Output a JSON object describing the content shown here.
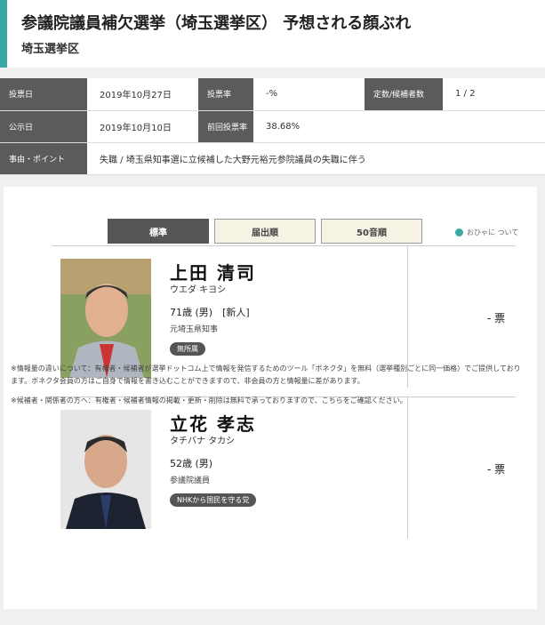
{
  "header": {
    "title": "参議院議員補欠選挙（埼玉選挙区） 予想される顔ぶれ",
    "subtitle": "埼玉選挙区"
  },
  "info": [
    {
      "label": "投票日",
      "value": "2019年10月27日"
    },
    {
      "label": "投票率",
      "value": "-%"
    },
    {
      "label": "定数/候補者数",
      "value": "1 / 2"
    },
    {
      "label": "公示日",
      "value": "2019年10月10日"
    },
    {
      "label": "前回投票率",
      "value": "38.68%"
    },
    {
      "label": "事由・ポイント",
      "value": "失職 / 埼玉県知事選に立候補した大野元裕元参院議員の失職に伴う"
    }
  ],
  "tabs": [
    {
      "label": "標準",
      "active": true
    },
    {
      "label": "届出順",
      "active": false
    },
    {
      "label": "50音順",
      "active": false
    }
  ],
  "legend": "おひゃに ついて",
  "candidates": [
    {
      "name": "上田 清司",
      "kana": "ウエダ キヨシ",
      "age": "71歳 (男)",
      "status": "[新人]",
      "role": "元埼玉県知事",
      "party": "無所属",
      "votes": "- 票"
    },
    {
      "name": "立花 孝志",
      "kana": "タチバナ タカシ",
      "age": "52歳 (男)",
      "status": "",
      "role": "参議院議員",
      "party": "NHKから国民を守る党",
      "votes": "- 票"
    }
  ],
  "notes": [
    "※情報量の違いについて：有権者・候補者が選挙ドットコム上で情報を発信するためのツール「ボネクタ」を無料（選挙種別ごとに同一価格）でご提供しております。ボネクタ会員の方はご自身で情報を書き込むことができますので、非会員の方と情報量に差があります。",
    "※候補者・関係者の方へ：有権者・候補者情報の掲載・更新・削除は無料で承っておりますので、こちらをご確認ください。"
  ]
}
